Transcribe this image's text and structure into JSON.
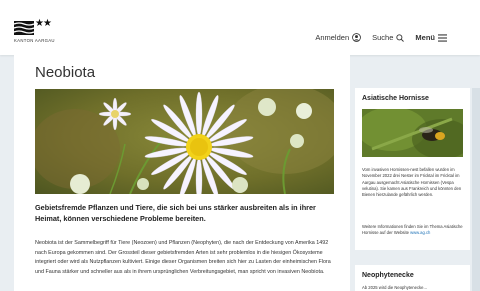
{
  "header": {
    "logo_text": "KANTON AARGAU",
    "logo_stars": "★★",
    "nav": {
      "login": "Anmelden",
      "search": "Suche",
      "menu": "Menü"
    }
  },
  "main": {
    "title": "Neobiota",
    "lead": "Gebietsfremde Pflanzen und Tiere, die sich bei uns stärker ausbreiten als in ihrer Heimat, können verschiedene Probleme bereiten.",
    "body": "Neobiota ist der Sammelbegriff für Tiere (Neozoen) und Pflanzen (Neophyten), die nach der Entdeckung von Amerika 1492 nach Europa gekommen sind. Der Grossteil dieser gebietsfremden Arten ist sehr problemlos in die hiesigen Ökosysteme integriert oder wird als Nutzpflanzen kultiviert. Einige dieser Organismen breiten sich hier zu Lasten der einheimischen Flora und Fauna stärker und schneller aus als in ihrem ursprünglichen Verbreitungsgebiet, man spricht von invasiven Neobiota."
  },
  "sidebar": {
    "card1": {
      "title": "Asiatische Hornisse",
      "text": "Vom invasiven Hornissen-nest befallen wurden im November 2022 drei Nester im Fricktal im Fricktal im Aargau ausgemacht Asiatische Hornissen (Vespa velutina). Sie kamen aus Frankreich und könnten den Bienen hierzulande gefährlich werden.",
      "more_prefix": "Weitere Informationen finden Sie im Thema Asiatische Hornisse auf der Website",
      "more_link": "www.ag.ch"
    },
    "card2": {
      "title": "Neophytenecke",
      "text": "Ab 2025 wird die Neophytenecke..."
    }
  },
  "colors": {
    "link": "#1a6fb5",
    "background": "#e9eef2",
    "petal": "#f6f3ff",
    "flower_center": "#f2d21a"
  },
  "icons": {
    "login": "user-circle-icon",
    "search": "search-icon",
    "menu": "hamburger-icon"
  }
}
